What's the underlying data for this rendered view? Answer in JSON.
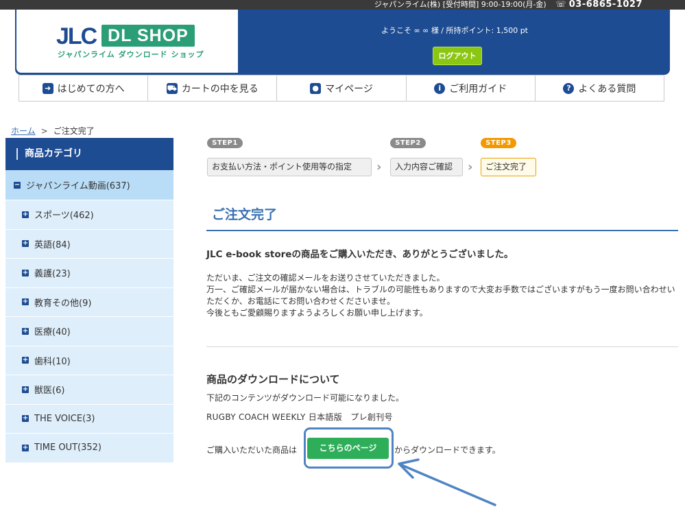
{
  "topbar": {
    "company_hours": "ジャパンライム(株) [受付時間] 9:00-19:00(月-金)",
    "phone": "03-6865-1027"
  },
  "header": {
    "logo_jlc": "JLC",
    "logo_dl_shop": "DL SHOP",
    "logo_subtitle": "ジャパンライム ダウンロード ショップ",
    "welcome": "ようこそ ∞ ∞ 様 / 所持ポイント: 1,500 pt",
    "logout_label": "ログアウト"
  },
  "nav": {
    "items": [
      {
        "label": "はじめての方へ",
        "icon": "arrow-right-icon"
      },
      {
        "label": "カートの中を見る",
        "icon": "cart-icon"
      },
      {
        "label": "マイページ",
        "icon": "user-icon"
      },
      {
        "label": "ご利用ガイド",
        "icon": "info-icon"
      },
      {
        "label": "よくある質問",
        "icon": "question-icon"
      }
    ]
  },
  "breadcrumb": {
    "home": "ホーム",
    "separator": ">",
    "current": "ご注文完了"
  },
  "sidebar": {
    "title": "商品カテゴリ",
    "main_category": "ジャパンライム動画(637)",
    "sub_categories": [
      "スポーツ(462)",
      "英語(84)",
      "義護(23)",
      "教育その他(9)",
      "医療(40)",
      "歯科(10)",
      "獣医(6)",
      "THE VOICE(3)",
      "TIME OUT(352)"
    ]
  },
  "steps": [
    {
      "badge": "STEP1",
      "label": "お支払い方法・ポイント使用等の指定"
    },
    {
      "badge": "STEP2",
      "label": "入力内容ご確認"
    },
    {
      "badge": "STEP3",
      "label": "ご注文完了"
    }
  ],
  "main": {
    "title": "ご注文完了",
    "thanks": "JLC e-book storeの商品をご購入いただき、ありがとうございました。",
    "message_lines": [
      "ただいま、ご注文の確認メールをお送りさせていただきました。",
      "万一、ご確認メールが届かない場合は、トラブルの可能性もありますので大変お手数ではございますがもう一度お問い合わせいただくか、お電話にてお問い合わせくださいませ。",
      "今後ともご愛顧賜りますようよろしくお願い申し上げます。"
    ],
    "download_title": "商品のダウンロードについて",
    "download_desc": "下記のコンテンツがダウンロード可能になりました。",
    "product_name": "RUGBY COACH WEEKLY 日本語版　プレ創刊号",
    "download_before": "ご購入いただいた商品は",
    "download_button": "こちらのページ",
    "download_after": "からダウンロードできます。"
  },
  "colors": {
    "brand_blue": "#1e4c92",
    "accent_green": "#2fae5a",
    "logout_green": "#8bc712",
    "step_active": "#f39800",
    "highlight_blue": "#4f84c4"
  }
}
